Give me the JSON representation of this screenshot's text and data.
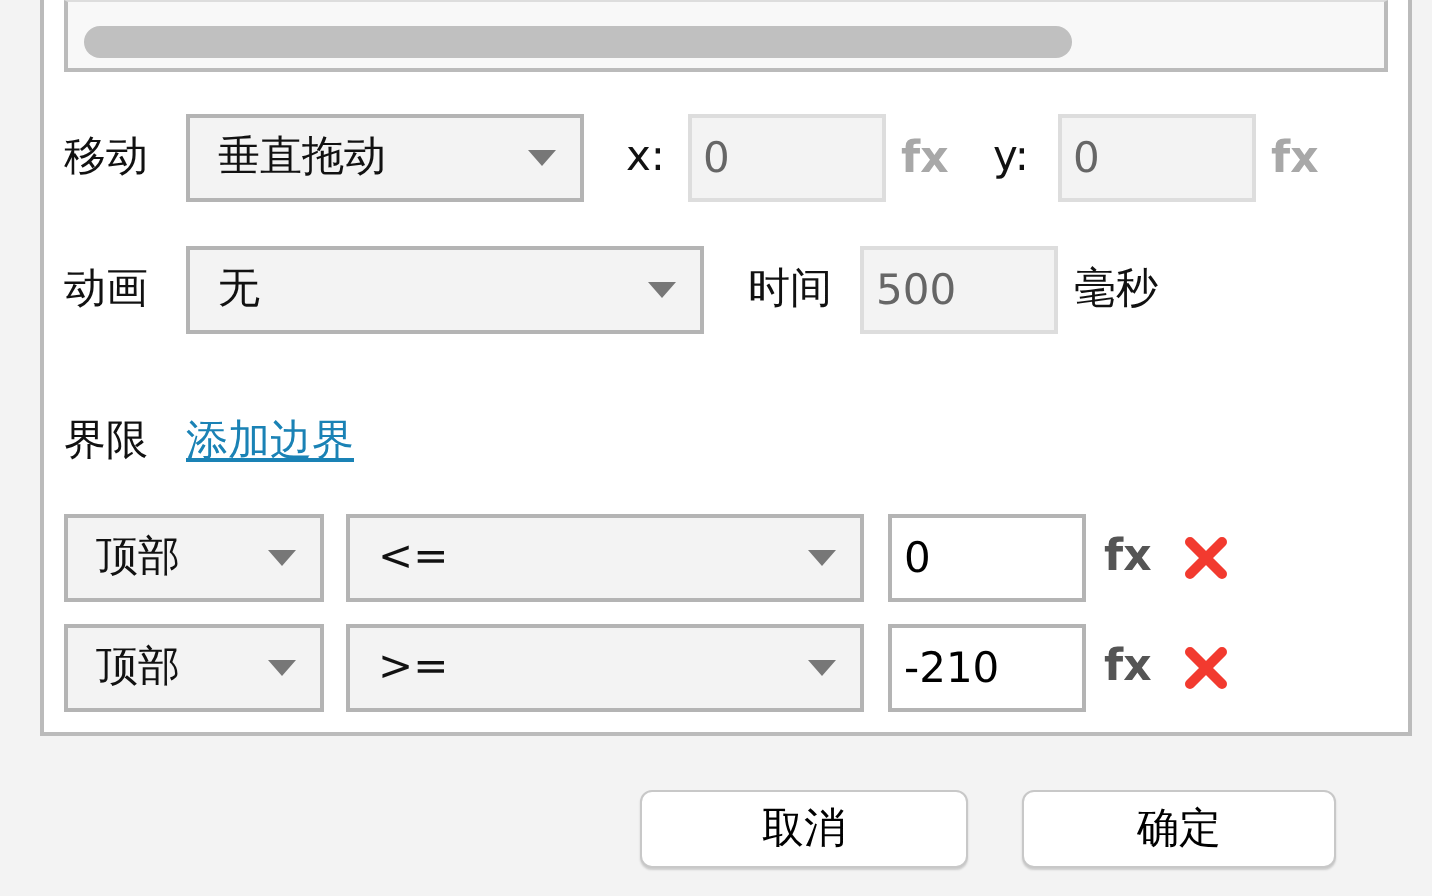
{
  "move": {
    "label": "移动",
    "select": "垂直拖动",
    "fields": [
      {
        "label": "x:",
        "value": "0",
        "disabled": true,
        "fx": "fx"
      },
      {
        "label": "y:",
        "value": "0",
        "disabled": true,
        "fx": "fx"
      }
    ]
  },
  "animation": {
    "label": "动画",
    "select": "无",
    "time_label": "时间",
    "time": {
      "value": "500",
      "disabled": true
    },
    "unit": "毫秒"
  },
  "limits": {
    "label": "界限",
    "link": "添加边界",
    "rows": [
      {
        "side": "顶部",
        "operator": "<=",
        "value": "0",
        "disabled": false,
        "fx": "fx"
      },
      {
        "side": "顶部",
        "operator": ">=",
        "value": "-210",
        "disabled": false,
        "fx": "fx"
      }
    ]
  },
  "buttons": [
    "取消",
    "确定"
  ]
}
